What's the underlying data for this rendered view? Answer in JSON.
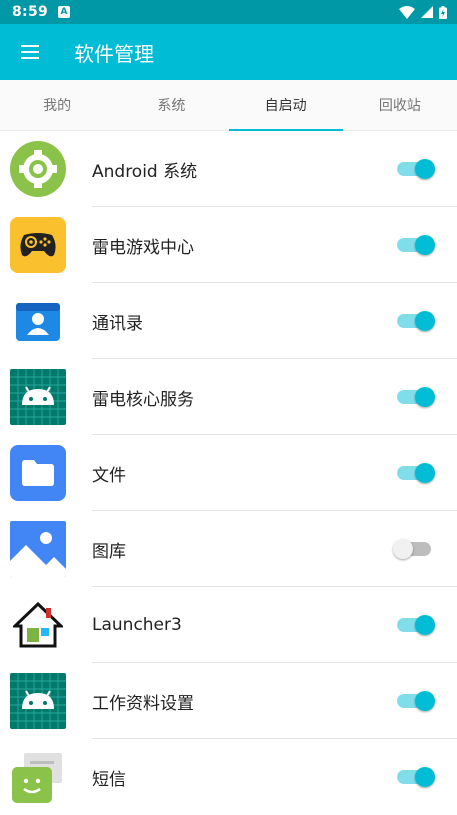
{
  "status_bar": {
    "time": "8:59",
    "notification_glyph": "A"
  },
  "app_bar": {
    "title": "软件管理"
  },
  "tabs": [
    {
      "label": "我的",
      "active": false
    },
    {
      "label": "系统",
      "active": false
    },
    {
      "label": "自启动",
      "active": true
    },
    {
      "label": "回收站",
      "active": false
    }
  ],
  "apps": [
    {
      "name": "Android 系统",
      "enabled": true,
      "icon": "android-settings-gear-icon"
    },
    {
      "name": "雷电游戏中心",
      "enabled": true,
      "icon": "gamepad-icon"
    },
    {
      "name": "通讯录",
      "enabled": true,
      "icon": "contacts-icon"
    },
    {
      "name": "雷电核心服务",
      "enabled": true,
      "icon": "android-robot-icon"
    },
    {
      "name": "文件",
      "enabled": true,
      "icon": "folder-icon"
    },
    {
      "name": "图库",
      "enabled": false,
      "icon": "gallery-icon"
    },
    {
      "name": "Launcher3",
      "enabled": true,
      "icon": "launcher-house-icon"
    },
    {
      "name": "工作资料设置",
      "enabled": true,
      "icon": "android-robot-icon"
    },
    {
      "name": "短信",
      "enabled": true,
      "icon": "messaging-icon"
    }
  ],
  "colors": {
    "accent": "#00bcd4",
    "status_bar": "#0097a7",
    "switch_track_on": "#80deea"
  }
}
